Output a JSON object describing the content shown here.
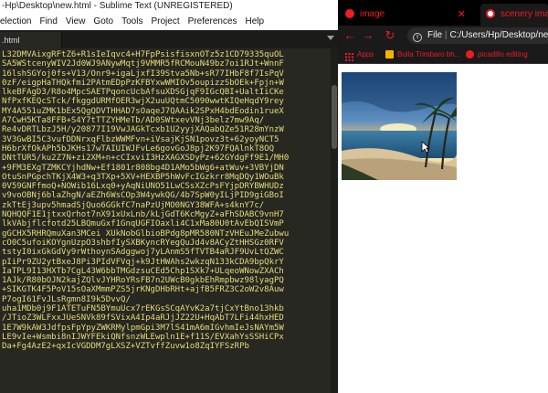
{
  "editor": {
    "title": "C:\\Users\\Hp\\Desktop\\new.html - Sublime Text (UNREGISTERED)",
    "title_visible": "-Hp\\Desktop\\new.html - Sublime Text (UNREGISTERED)",
    "menu": [
      "election",
      "Find",
      "View",
      "Goto",
      "Tools",
      "Project",
      "Preferences",
      "Help"
    ],
    "tab_label": ".html",
    "code_lines": [
      "L32DMVAixgRFtZ6+R1sIeIqvc4+H7FpPsisfisxnOTz5z1CD79335quOL",
      "SA5WStcenyWIV2Jd0WJ9ANywMqtj9VMMR5fRCMouN49bz7oi1RJt+WnnF",
      "16lshSGYoj0fs+V13/Onr9+igaLjxfI39Stva5Nb+sR77IHbF8f7IsPqV",
      "0zF/eigpHaTHQkfmi2PAtmEDpPzKFBYxwWMIOv5oupizzSbOEk+Fpjn+W",
      "lkeBFAgD3/R8o4MpcSAETPqoncUcbAfsuXDSGjqF9IGcQBI+UaltIiCKe",
      "NfPxfKEQcSTck/fkggdURMfOER3wjX2uuUQtmC5090wwtKIQeHqdY9rey",
      "MY4A551uZMK1bEx5QgQDVTHHAD7sOaqeJ7QAAik2SPxH4bdEodin1rueX",
      "A7CwH5KTa8FFB+S4Y7tTTZYHMeTb/AD0SWtxevVNj3belz7mw9Aq/",
      "Re4vDRTLbzJ5H/y20877I19VwJAGkTcxb1U2yyjXAQabQZe51R28mYnzW",
      "3V3GwBI5C3vufDDNrxqFlbzWWMFvn+iVsajKjSN1povz3t+62yoyNCT5",
      "H6brXfOkAPh5bJKHs17wTAIUIWJFvLe6govGoJ8pj2K97FQAlnkT8OQ",
      "DNtTUR5/ku2Z7N+zi2XM+n+cCIxviI3HzXAGXSDyPz+62GYdgFf9E1/MH0",
      "+9FM3EXgTZMKCYjhdNw+Ef1801r808bg4D1AMo5bWg6+atWuv+3VBYjDN",
      "OtuSnPGpchTKjX4W3+q3TXp+5XV+HEXBP5hWvFcIGzkrr8MqDQy1WOuBk",
      "0V59GNFfmoQ+NOWib16Lxq0+yAqNiUNO51LwCSsXZcPsFYjpDRYBWHUDz",
      "v9voOBNj6blaZhgN/aEZh6WsCOp3W4ywkQG/4b7SpW0yILjPID9giGBoI",
      "zkTtEj3upv5hmadSjQuo6GGkfC7naPzUjMO0NGY38WFA+s4knY7c/",
      "NQHQQF1E1jtxxQrhot7nX91xUxLnb/kLjGdT6KcMgyZ+aFhSDABC9vnH7",
      "lkVAbjflcfotd25LBQmuGxf1GnqUGFIOaxli4C1xMa80U0tAvEbQISVmP",
      "gGCHX5RHRQmuXan3MCei XUkNobGlbioBPdg8pMR580NTzVHEuJMeZubwu",
      "cO0C5ufoiKOYgnUzpO3shbfIySXBKyncRYegQuJd4v8ACyZtHHSGz0RFV",
      "tstyI0ixGkGdVy9rWthoynSAdggwoj7yLAnmS5fTVTB4aRJF9UvLtQZWC",
      "pIiPr9ZU2ytBxeJ8Pi3PIdVFVqj+k9JtHWAhs2wkzqN133kCDA9bpQkrY",
      "IaTPL9I13HXTb7CgL43W6bbTMGdzsuCEd5Chp1SXk7+ULqeoWNowZXACh",
      "1AJk/R80bOJN2kajZQlvJYHRoYRsFB7n2UWcB0gkbEhRmpbwz98lyagPQ",
      "+SIKGTK4F5PoV15sOaXMmmPZS5jrKNgDHbRHt+ajfB5FRZ3C2oW2v8Auw",
      "P7ogI61FvJLsRgmn8I9k5DvvQ/",
      "uha1MDb0j9F1ATETuFN5BYmuUcx7rEKGsSCqAYvK2a7tjCxYtBno13hkb",
      "/JTioZ3WLFxxJUeSNVk89fSVixA4Ip4aRJjJZ22U+HqAbT7LFi44hxHED",
      "1E7W9kAW3JdfpsFpYpyZWKRMylpmGpi3M7lS41mA6mIGvhmIeJsNAYm5W",
      "LE9vIe+Wsmbi8nIJWYFEkiQNfsnzWLEwpln1E+f11S/EVXahYsSSHiCPx",
      "Da+Fg4AzE2+qxIcVGDDM7gLXSZ+VZTvffZuvw1o8ZqIYFSzRPb"
    ]
  },
  "browser": {
    "tabs": [
      {
        "label": "image"
      },
      {
        "label": "scenery image"
      }
    ],
    "url": "C:/Users/Hp/Desktop/ne",
    "url_prefix": "File",
    "bookmarks": [
      "Apps",
      "Bulla Trimbaro bh...",
      "picadillo editing"
    ],
    "image_alt": "beach scenery with palm trees and sunset"
  },
  "colors": {
    "editor_bg": "#272822",
    "code_text": "#e6db74",
    "browser_accent": "#ee1c24",
    "chrome_dark": "#1a1a1a"
  }
}
